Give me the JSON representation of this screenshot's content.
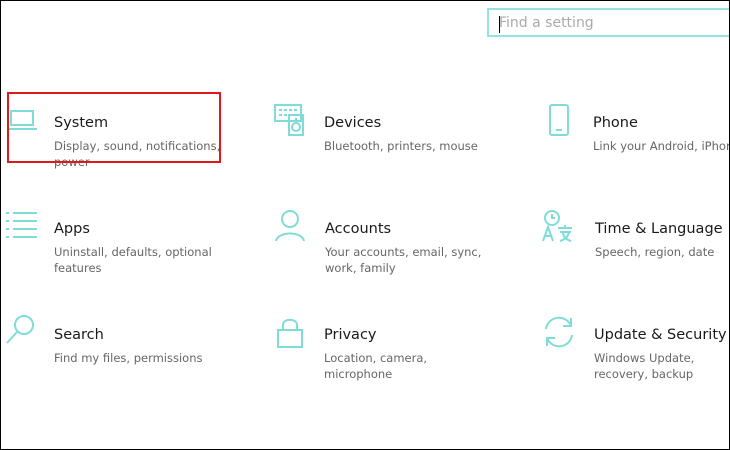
{
  "search": {
    "placeholder": "Find a setting"
  },
  "colors": {
    "accent": "#7fdcd6",
    "search_border": "#96e3e3",
    "highlight": "#e0181c"
  },
  "tiles": [
    {
      "icon": "laptop-icon",
      "title": "System",
      "desc": "Display, sound, notifications, power"
    },
    {
      "icon": "devices-icon",
      "title": "Devices",
      "desc": "Bluetooth, printers, mouse"
    },
    {
      "icon": "phone-icon",
      "title": "Phone",
      "desc": "Link your Android, iPhone"
    },
    {
      "icon": "apps-icon",
      "title": "Apps",
      "desc": "Uninstall, defaults, optional features"
    },
    {
      "icon": "accounts-icon",
      "title": "Accounts",
      "desc": "Your accounts, email, sync, work, family"
    },
    {
      "icon": "time-language-icon",
      "title": "Time & Language",
      "desc": "Speech, region, date"
    },
    {
      "icon": "search-icon",
      "title": "Search",
      "desc": "Find my files, permissions"
    },
    {
      "icon": "lock-icon",
      "title": "Privacy",
      "desc": "Location, camera, microphone"
    },
    {
      "icon": "update-icon",
      "title": "Update & Security",
      "desc": "Windows Update, recovery, backup"
    }
  ]
}
